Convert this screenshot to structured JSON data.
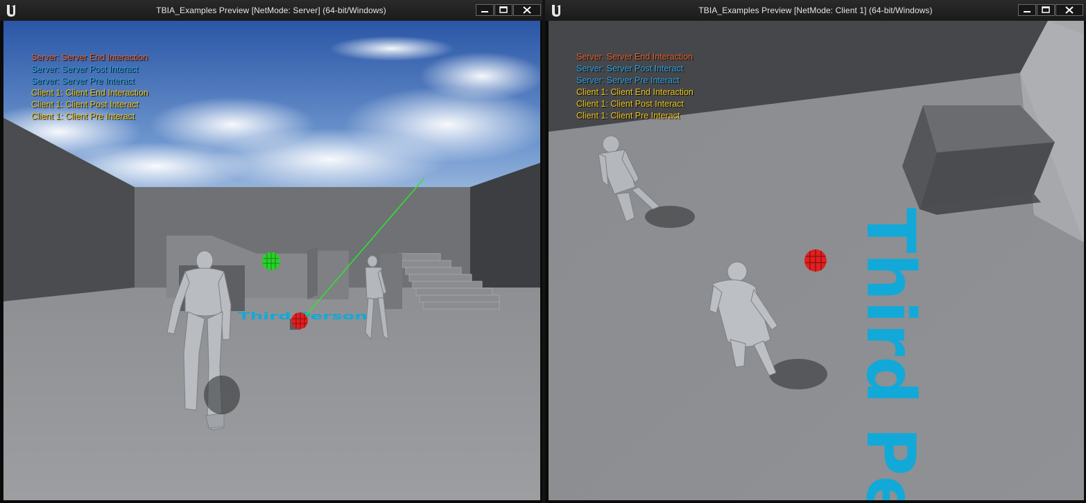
{
  "windows": {
    "server": {
      "title": "TBIA_Examples Preview [NetMode: Server]  (64-bit/Windows)",
      "log": [
        {
          "text": "Server: Server End Interaction",
          "color": "#e8622a"
        },
        {
          "text": "Server: Server Post Interact",
          "color": "#2ea3e0"
        },
        {
          "text": "Server: Server Pre Interact",
          "color": "#2ea3e0"
        },
        {
          "text": "Client 1: Client End Interaction",
          "color": "#f0c419"
        },
        {
          "text": "Client 1: Client Post Interact",
          "color": "#f0c419"
        },
        {
          "text": "Client 1: Client Pre Interact",
          "color": "#f0c419"
        }
      ],
      "floor_text": "Third Person"
    },
    "client": {
      "title": "TBIA_Examples Preview [NetMode: Client 1]  (64-bit/Windows)",
      "log": [
        {
          "text": "Server: Server End Interaction",
          "color": "#e8622a"
        },
        {
          "text": "Server: Server Post Interact",
          "color": "#2ea3e0"
        },
        {
          "text": "Server: Server Pre Interact",
          "color": "#2ea3e0"
        },
        {
          "text": "Client 1: Client End Interaction",
          "color": "#f0c419"
        },
        {
          "text": "Client 1: Client Post Interact",
          "color": "#f0c419"
        },
        {
          "text": "Client 1: Client Pre Interact",
          "color": "#f0c419"
        }
      ],
      "floor_text": "Third Pe"
    }
  },
  "icons": {
    "logo": "unreal-logo-icon",
    "minimize": "minimize-icon",
    "maximize": "maximize-icon",
    "close": "close-icon"
  },
  "colors": {
    "floor_text": "#12a9d8",
    "interact_sphere_red": "#e02020",
    "interact_sphere_green": "#2ad02a",
    "trace_line": "#2be82b"
  }
}
